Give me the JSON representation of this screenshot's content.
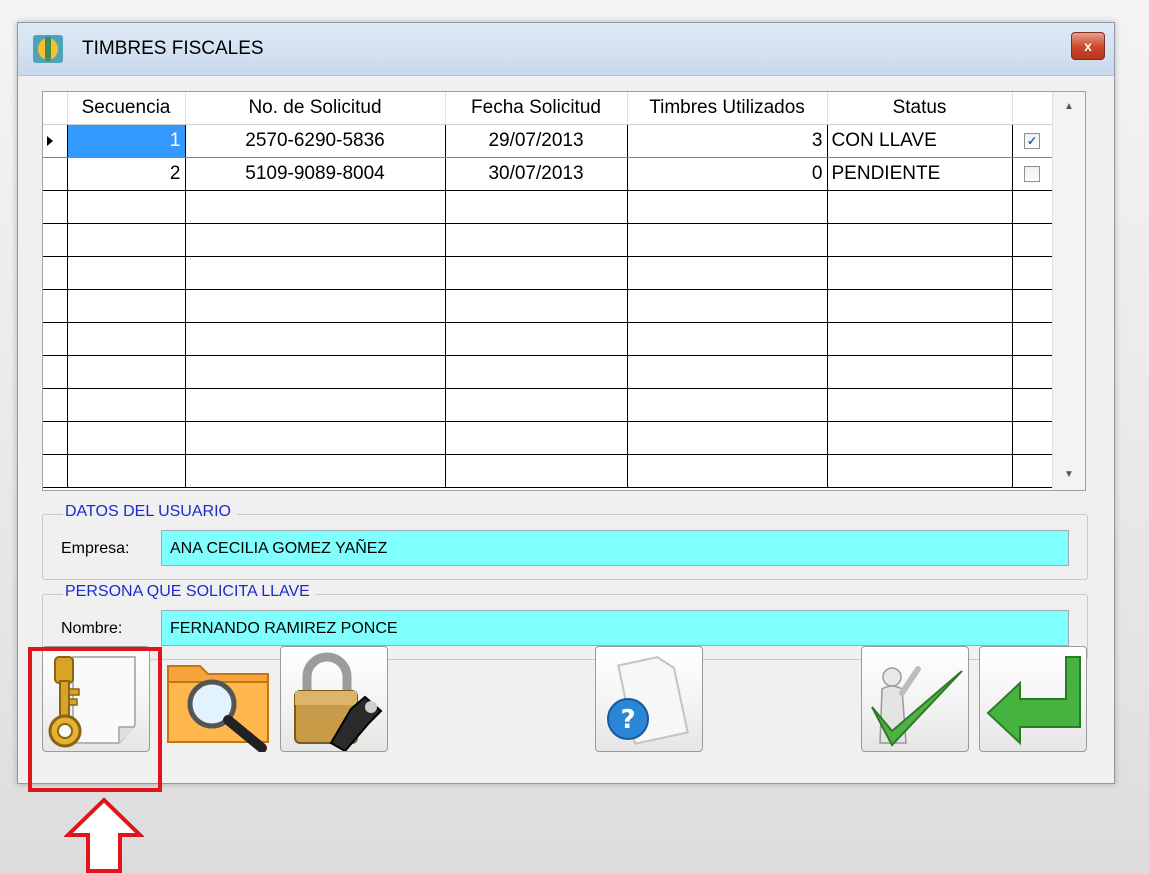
{
  "window": {
    "title": "TIMBRES FISCALES",
    "close_label": "x"
  },
  "grid": {
    "columns": [
      "Secuencia",
      "No. de Solicitud",
      "Fecha Solicitud",
      "Timbres Utilizados",
      "Status",
      ""
    ],
    "rows": [
      {
        "secuencia": "1",
        "solicitud": "2570-6290-5836",
        "fecha": "29/07/2013",
        "timbres": "3",
        "status": "CON LLAVE",
        "checked": true
      },
      {
        "secuencia": "2",
        "solicitud": "5109-9089-8004",
        "fecha": "30/07/2013",
        "timbres": "0",
        "status": "PENDIENTE",
        "checked": false
      }
    ],
    "empty_rows": 9
  },
  "usuario": {
    "legend": "DATOS DEL USUARIO",
    "label": "Empresa:",
    "value": "ANA CECILIA GOMEZ YAÑEZ"
  },
  "persona": {
    "legend": "PERSONA QUE SOLICITA LLAVE",
    "label": "Nombre:",
    "value": "FERNANDO RAMIREZ PONCE"
  },
  "toolbar": {
    "buttons": [
      "key-document-icon",
      "folder-search-icon",
      "padlock-key-icon",
      "help-document-icon",
      "checkmark-person-icon",
      "return-arrow-icon"
    ]
  },
  "colors": {
    "field_bg": "#80ffff",
    "legend": "#1a2bd0",
    "highlight": "#e0141b",
    "selection": "#3399ff"
  }
}
